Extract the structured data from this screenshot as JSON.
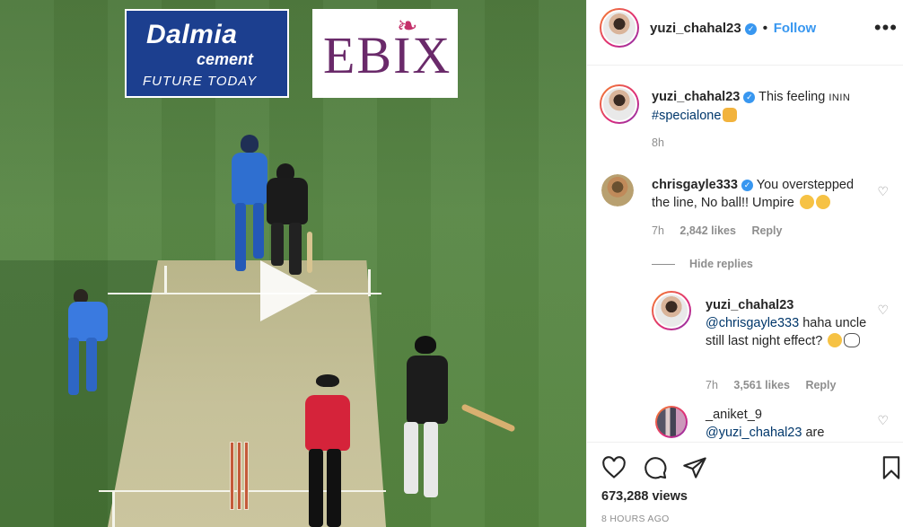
{
  "ads": {
    "dalmia_name": "Dalmia",
    "dalmia_sub": "cement",
    "dalmia_tag": "FUTURE TODAY",
    "ebix": "EBIX"
  },
  "header": {
    "username": "yuzi_chahal23",
    "separator": "•",
    "follow_label": "Follow",
    "more": "•••"
  },
  "caption": {
    "username": "yuzi_chahal23",
    "text": "This feeling",
    "smallcaps": "ININ",
    "hashtag": "#specialone",
    "time": "8h"
  },
  "comments": [
    {
      "username": "chrisgayle333",
      "text": "You overstepped the line, No ball!! Umpire",
      "time": "7h",
      "likes": "2,842 likes",
      "reply": "Reply"
    }
  ],
  "hide_replies": "Hide replies",
  "replies": [
    {
      "username": "yuzi_chahal23",
      "mention": "@chrisgayle333",
      "text": "haha uncle still last night effect?",
      "time": "7h",
      "likes": "3,561 likes",
      "reply": "Reply"
    },
    {
      "username": "_aniket_9",
      "mention": "@yuzi_chahal23",
      "text": "are"
    }
  ],
  "footer": {
    "views": "673,288 views",
    "time_ago": "8 HOURS AGO"
  },
  "icons": {
    "like": "heart-icon",
    "comment": "comment-icon",
    "share": "share-icon",
    "save": "bookmark-icon",
    "play": "play-icon"
  },
  "colors": {
    "accent": "#3897f0",
    "link": "#00376b",
    "muted": "#8e8e8e"
  }
}
